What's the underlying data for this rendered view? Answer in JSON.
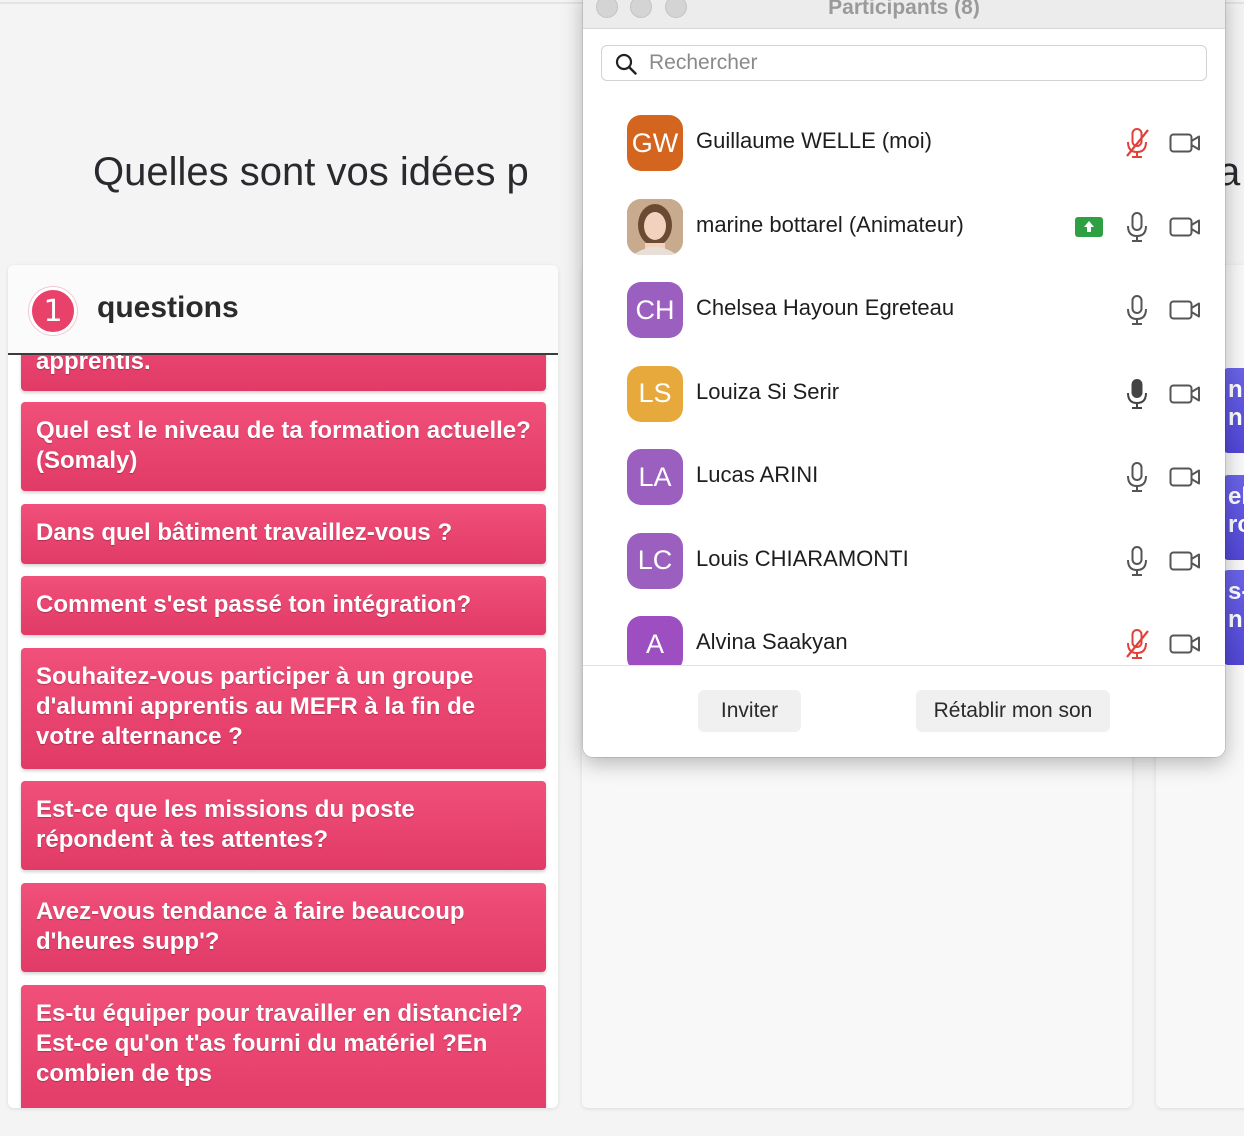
{
  "background": {
    "title": "Quelles sont vos idées p",
    "title_tail": "a",
    "column1": {
      "count": "1",
      "label": "questions",
      "cards": [
        "apprentis.",
        "Quel est le niveau de ta formation actuelle? (Somaly)",
        "Dans quel bâtiment travaillez-vous ?",
        "Comment s'est passé ton intégration?",
        "Souhaitez-vous participer à un groupe d'alumni apprentis au MEFR à la fin de votre alternance ?",
        "Est-ce que les missions du poste répondent à tes attentes?",
        "Avez-vous tendance à faire beaucoup d'heures supp'?",
        "Es-tu équiper pour travailler en distanciel? Est-ce qu'on t'as fourni du matériel ?En combien de tps"
      ]
    },
    "column3": {
      "fragments": [
        "nr",
        "nr",
        "els",
        "rcy",
        "s-",
        "nu"
      ]
    }
  },
  "participants_window": {
    "title": "Participants (8)",
    "search": {
      "placeholder": "Rechercher",
      "value": ""
    },
    "participants": [
      {
        "initials": "GW",
        "name": "Guillaume WELLE (moi)",
        "avatar_color": "#d4651f",
        "mic": "muted",
        "video": "off",
        "sharing": false
      },
      {
        "initials": "",
        "name": "marine bottarel (Animateur)",
        "avatar_color": "#c9a98b",
        "mic": "on",
        "video": "off",
        "sharing": true,
        "photo": true
      },
      {
        "initials": "CH",
        "name": "Chelsea Hayoun Egreteau",
        "avatar_color": "#9b5fc0",
        "mic": "on",
        "video": "off",
        "sharing": false
      },
      {
        "initials": "LS",
        "name": "Louiza Si Serir",
        "avatar_color": "#e7a93b",
        "mic": "speaking",
        "video": "off",
        "sharing": false
      },
      {
        "initials": "LA",
        "name": "Lucas ARINI",
        "avatar_color": "#9b5fc0",
        "mic": "on",
        "video": "off",
        "sharing": false
      },
      {
        "initials": "LC",
        "name": "Louis CHIARAMONTI",
        "avatar_color": "#9b5fc0",
        "mic": "on",
        "video": "off",
        "sharing": false
      },
      {
        "initials": "A",
        "name": "Alvina Saakyan",
        "avatar_color": "#9d4fc2",
        "mic": "muted",
        "video": "off",
        "sharing": false
      }
    ],
    "footer": {
      "invite_label": "Inviter",
      "unmute_label": "Rétablir mon son"
    }
  },
  "colors": {
    "card_red": "#e8416a",
    "muted_red": "#e0413a",
    "share_green": "#2ea043",
    "violet_card": "#5a50dd"
  }
}
